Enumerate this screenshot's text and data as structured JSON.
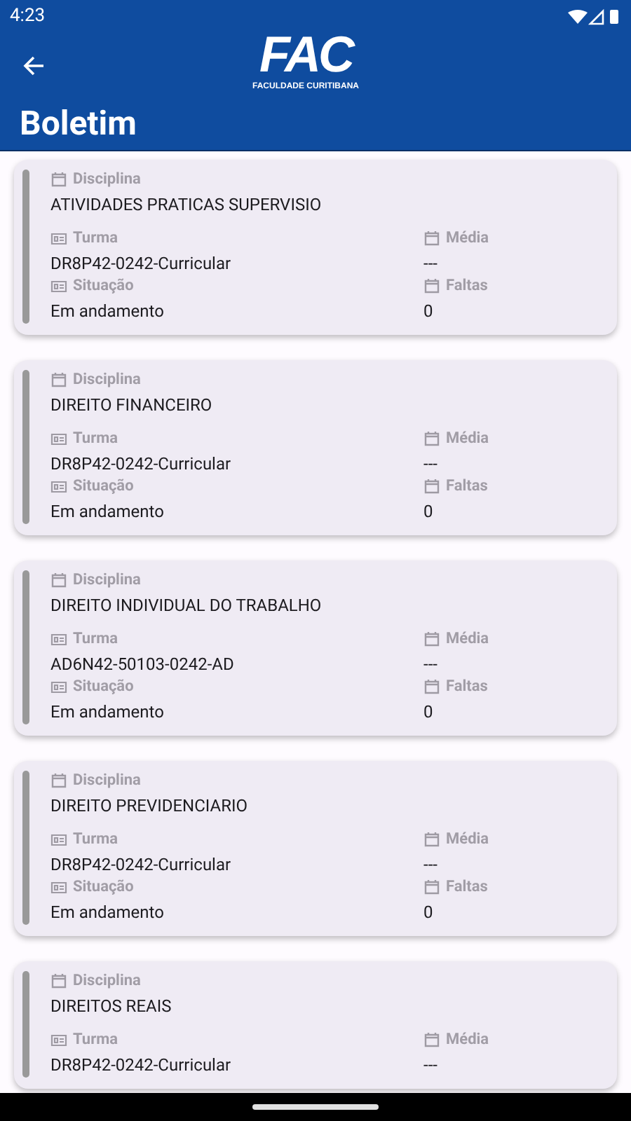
{
  "status_bar": {
    "time": "4:23"
  },
  "app_bar": {
    "logo": {
      "letters": "FAC",
      "subtitle": "FACULDADE CURITIBANA"
    },
    "title": "Boletim"
  },
  "cards": [
    {
      "fields": [
        {
          "kind": "calendar",
          "label": "Disciplina",
          "value": "ATIVIDADES PRATICAS SUPERVISIO"
        },
        {
          "kind": "id",
          "label": "Turma",
          "value": "DR8P42-0242-Curricular"
        },
        {
          "kind": "calendar",
          "label": "Média",
          "value": "---"
        },
        {
          "kind": "id",
          "label": "Situação",
          "value": "Em andamento"
        },
        {
          "kind": "calendar",
          "label": "Faltas",
          "value": "0"
        }
      ]
    },
    {
      "fields": [
        {
          "kind": "calendar",
          "label": "Disciplina",
          "value": "DIREITO FINANCEIRO"
        },
        {
          "kind": "id",
          "label": "Turma",
          "value": "DR8P42-0242-Curricular"
        },
        {
          "kind": "calendar",
          "label": "Média",
          "value": "---"
        },
        {
          "kind": "id",
          "label": "Situação",
          "value": "Em andamento"
        },
        {
          "kind": "calendar",
          "label": "Faltas",
          "value": "0"
        }
      ]
    },
    {
      "fields": [
        {
          "kind": "calendar",
          "label": "Disciplina",
          "value": "DIREITO INDIVIDUAL DO TRABALHO"
        },
        {
          "kind": "id",
          "label": "Turma",
          "value": "AD6N42-50103-0242-AD"
        },
        {
          "kind": "calendar",
          "label": "Média",
          "value": "---"
        },
        {
          "kind": "id",
          "label": "Situação",
          "value": "Em andamento"
        },
        {
          "kind": "calendar",
          "label": "Faltas",
          "value": "0"
        }
      ]
    },
    {
      "fields": [
        {
          "kind": "calendar",
          "label": "Disciplina",
          "value": "DIREITO PREVIDENCIARIO"
        },
        {
          "kind": "id",
          "label": "Turma",
          "value": "DR8P42-0242-Curricular"
        },
        {
          "kind": "calendar",
          "label": "Média",
          "value": "---"
        },
        {
          "kind": "id",
          "label": "Situação",
          "value": "Em andamento"
        },
        {
          "kind": "calendar",
          "label": "Faltas",
          "value": "0"
        }
      ]
    },
    {
      "fields": [
        {
          "kind": "calendar",
          "label": "Disciplina",
          "value": "DIREITOS REAIS"
        },
        {
          "kind": "id",
          "label": "Turma",
          "value": "DR8P42-0242-Curricular"
        },
        {
          "kind": "calendar",
          "label": "Média",
          "value": "---"
        }
      ]
    }
  ]
}
